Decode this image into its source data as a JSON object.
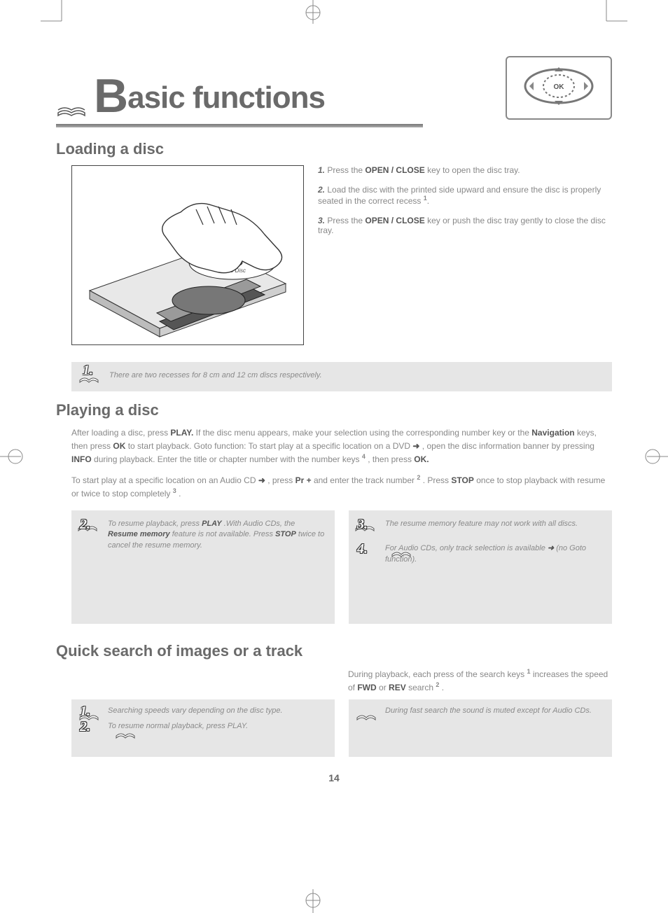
{
  "title_prefix_cap": "B",
  "title_rest": "asic functions",
  "sections": {
    "loading": {
      "heading": "Loading a disc",
      "steps": [
        {
          "num": "1.",
          "text_a": "Press the ",
          "kw": "OPEN / CLOSE",
          "text_b": " key to open the disc tray."
        },
        {
          "num": "2.",
          "text_a": "Load the disc with the printed side upward and ensure the disc is properly seated in the correct recess ",
          "kw": "",
          "text_b": "",
          "super": "1",
          "tail": "."
        },
        {
          "num": "3.",
          "text_a": "Press the ",
          "kw": "OPEN / CLOSE",
          "text_b": " key or push the disc tray gently to close the disc tray."
        }
      ],
      "note_num": "1.",
      "note_text": "There are two recesses for 8 cm and 12 cm discs respectively."
    },
    "playing": {
      "heading": "Playing a disc",
      "para1_a": "After loading a disc, press ",
      "para1_kw1": "PLAY.",
      "para1_b": " If the disc menu appears, make your selection using the corresponding number key or the ",
      "para1_kw2": "Navigation",
      "para1_c": " keys, then press ",
      "para1_kw3": "OK",
      "para1_d": " to start playback.",
      "para2_a": "Goto function: To start play at a specific location on a DVD ",
      "arrow": "➜",
      "para2_b": ", open the disc information banner by pressing ",
      "para2_kw": "INFO",
      "para2_c": " during playback. Enter the title or chapter number with the number keys ",
      "para2_sup": "4",
      "para2_d": ", then press ",
      "para2_kw2": "OK.",
      "para3_a": "To start play at a specific location on an Audio CD ",
      "para3_b": ", press ",
      "para3_kw": "Pr +",
      "para3_c": " and enter the track number ",
      "para3_sup": "2",
      "para3_d": ". Press ",
      "para3_kw2": "STOP",
      "para3_e": " once to stop playback with resume or twice to stop completely ",
      "para3_sup2": "3",
      "para3_f": ".",
      "notes": [
        {
          "num": "2.",
          "t1": "To resume playback, press ",
          "kw1": "PLAY",
          "t2": ".With Audio CDs, the ",
          "kw2": "Resume  memory",
          "t3": " feature is not available. Press ",
          "kw3": "STOP",
          "t4": " twice to cancel the resume memory."
        },
        {
          "num": "3.",
          "t1": "The resume memory feature may not work with all discs.",
          "kw1": "",
          "t2": "",
          "kw2": "",
          "t3": "",
          "kw3": "",
          "t4": ""
        },
        {
          "num": "4.",
          "t1": "For Audio CDs, only track selection is available ",
          "kw1": "",
          "t2": "",
          "kw2": "",
          "t3": "",
          "kw3": "",
          "t4": "",
          "arrow": "➜",
          "tail": " (no Goto function)."
        }
      ]
    },
    "quick": {
      "heading": "Quick search of images or a track",
      "left_a": "During playback, each press of the search keys ",
      "left_sup": "1",
      "left_b": " increases the speed of ",
      "left_kw1": "FWD",
      "left_c": " or ",
      "left_kw2": "REV",
      "left_d": " search ",
      "left_sup2": "2",
      "left_e": ".",
      "note1_num": "1.",
      "note1_text": "Searching speeds vary depending on the disc type.",
      "note2_num": "2.",
      "note2_text": "To resume normal playback, press PLAY.",
      "right_note": "During fast search the sound is muted except for Audio CDs."
    }
  },
  "page_number": "14"
}
